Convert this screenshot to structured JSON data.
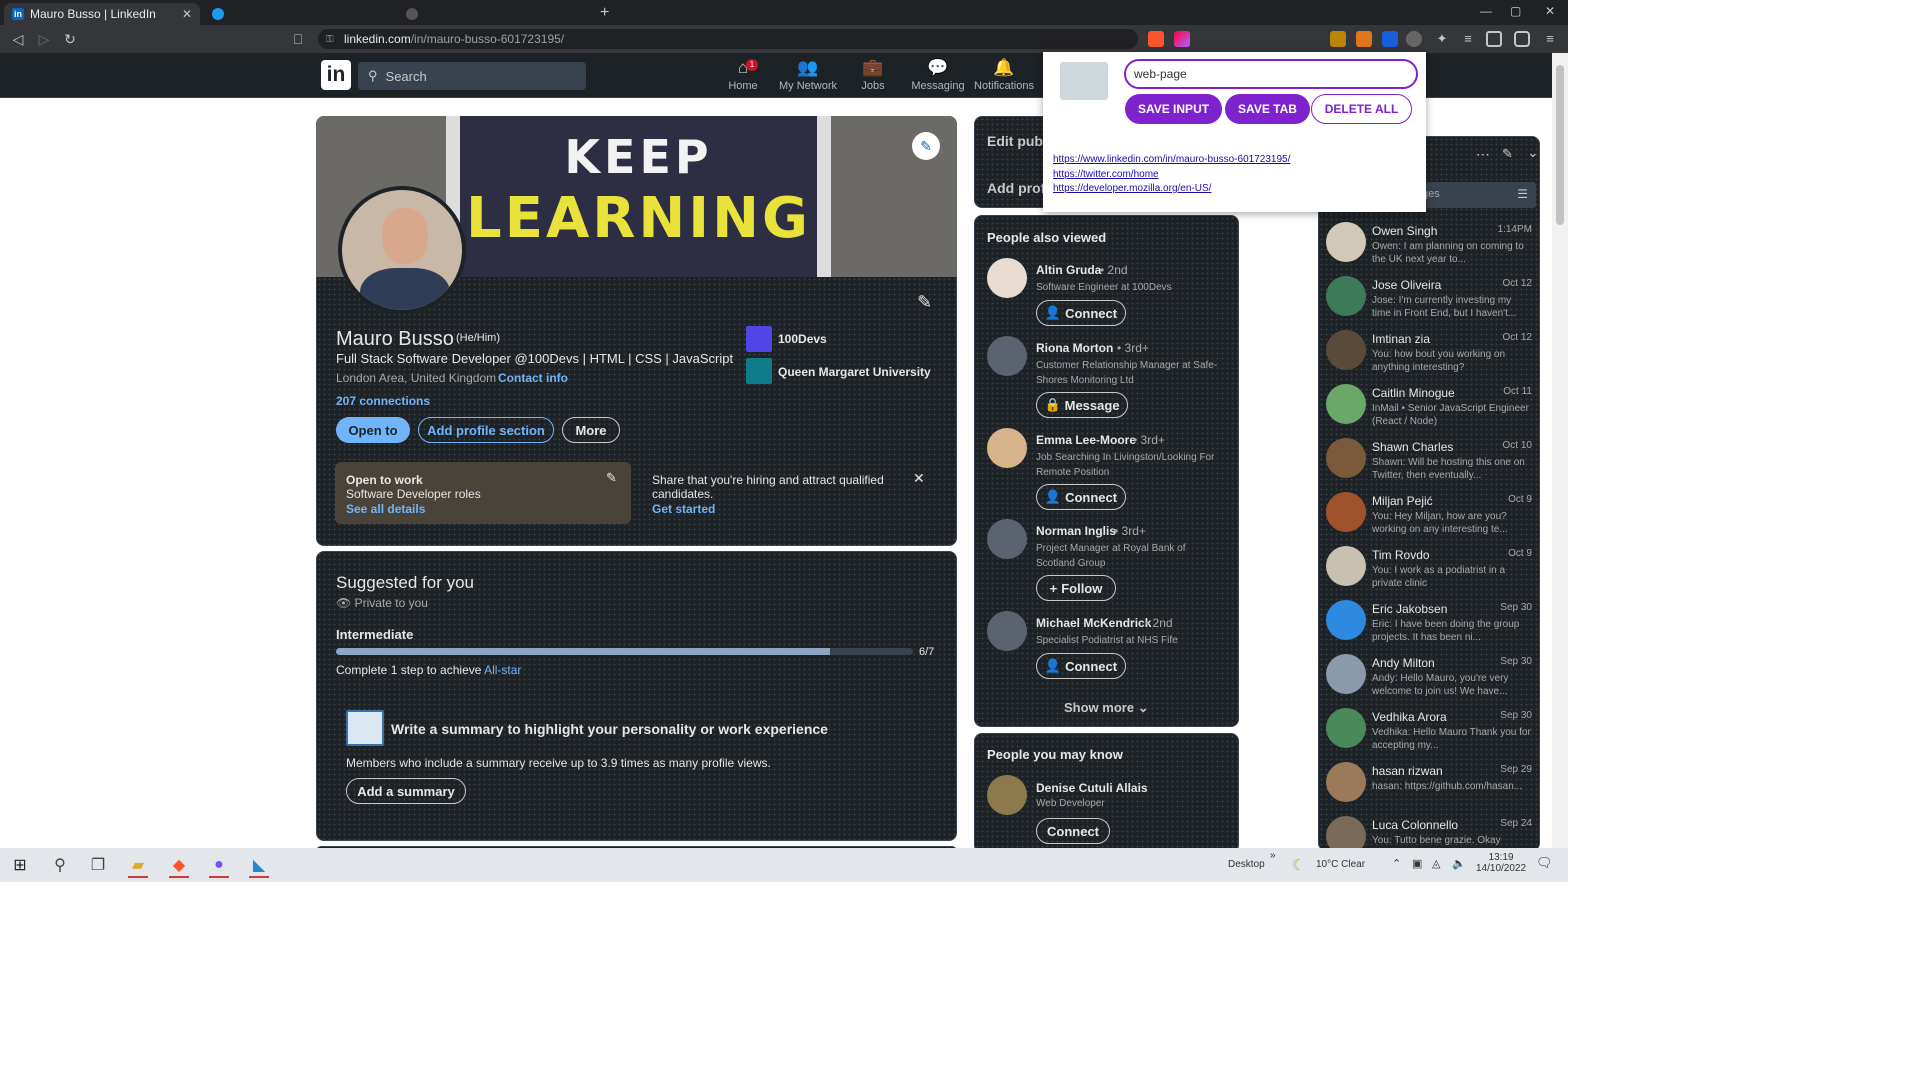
{
  "browser": {
    "active_tab_title": "Mauro Busso | LinkedIn",
    "url_host": "linkedin.com",
    "url_path": "/in/mauro-busso-601723195/",
    "new_tab_glyph": "+"
  },
  "linkedin_header": {
    "logo": "in",
    "search_placeholder": "Search",
    "nav": [
      {
        "label": "Home",
        "icon": "home-icon",
        "badge": "1"
      },
      {
        "label": "My Network",
        "icon": "network-icon"
      },
      {
        "label": "Jobs",
        "icon": "briefcase-icon"
      },
      {
        "label": "Messaging",
        "icon": "chat-icon"
      },
      {
        "label": "Notifications",
        "icon": "bell-icon"
      }
    ]
  },
  "profile": {
    "banner_line1": "KEEP",
    "banner_line2": "LEARNING",
    "name": "Mauro Busso",
    "pronouns": "(He/Him)",
    "headline": "Full Stack Software Developer @100Devs | HTML | CSS | JavaScript",
    "location": "London Area, United Kingdom",
    "contact_info": "Contact info",
    "connections": "207 connections",
    "orgs": [
      {
        "name": "100Devs",
        "color": "#4f46e5"
      },
      {
        "name": "Queen Margaret University",
        "color": "#0f7c8c"
      }
    ],
    "buttons": {
      "open_to": "Open to",
      "add_section": "Add profile section",
      "more": "More"
    },
    "open_to_work": {
      "title": "Open to work",
      "roles": "Software Developer roles",
      "link": "See all details"
    },
    "hiring": {
      "text": "Share that you're hiring and attract qualified candidates.",
      "link": "Get started"
    }
  },
  "suggested": {
    "title": "Suggested for you",
    "privacy": "Private to you",
    "level": "Intermediate",
    "progress": 0.857,
    "progress_label": "6/7",
    "step_text": "Complete 1 step to achieve",
    "step_link": "All-star",
    "summary_title": "Write a summary to highlight your personality or work experience",
    "summary_desc": "Members who include a summary receive up to 3.9 times as many profile views.",
    "summary_button": "Add a summary"
  },
  "right_col": {
    "edit_public": "Edit publ",
    "add_profile": "Add prof",
    "people_also_viewed_title": "People also viewed",
    "people_also_viewed": [
      {
        "name": "Altin Gruda",
        "degree": "• 2nd",
        "headline": "Software Engineer at 100Devs",
        "action": "Connect"
      },
      {
        "name": "Riona Morton",
        "degree": "• 3rd+",
        "headline": "Customer Relationship Manager at Safe-Shores Monitoring Ltd",
        "action": "Message"
      },
      {
        "name": "Emma Lee-Moore",
        "degree": "• 3rd+",
        "headline": "Job Searching In Livingston/Looking For Remote Position",
        "action": "Connect"
      },
      {
        "name": "Norman Inglis",
        "degree": "• 3rd+",
        "headline": "Project Manager at Royal Bank of Scotland Group",
        "action": "Follow"
      },
      {
        "name": "Michael McKendrick",
        "degree": "• 2nd",
        "headline": "Specialist Podiatrist at NHS Fife",
        "action": "Connect"
      }
    ],
    "show_more": "Show more",
    "people_may_know_title": "People you may know",
    "people_may_know": [
      {
        "name": "Denise Cutuli Allais",
        "headline": "Web Developer",
        "action": "Connect"
      }
    ]
  },
  "messaging": {
    "search_placeholder": "ges",
    "conversations": [
      {
        "name": "Owen Singh",
        "date": "1:14PM",
        "snippet": "Owen: I am planning on coming to the UK next year to..."
      },
      {
        "name": "Jose Oliveira",
        "date": "Oct 12",
        "snippet": "Jose: I'm currently investing my time in Front End, but I haven't..."
      },
      {
        "name": "Imtinan zia",
        "date": "Oct 12",
        "snippet": "You: how bout you working on anything interesting?"
      },
      {
        "name": "Caitlin Minogue",
        "date": "Oct 11",
        "snippet": "InMail • Senior JavaScript Engineer (React / Node)"
      },
      {
        "name": "Shawn Charles",
        "date": "Oct 10",
        "snippet": "Shawn: Will be hosting this one on Twitter, then eventually..."
      },
      {
        "name": "Miljan Pejić",
        "date": "Oct 9",
        "snippet": "You: Hey Miljan, how are you? working on any interesting te..."
      },
      {
        "name": "Tim Rovdo",
        "date": "Oct 9",
        "snippet": "You: I work as a podiatrist in a private clinic"
      },
      {
        "name": "Eric Jakobsen",
        "date": "Sep 30",
        "snippet": "Eric: I have been doing the group projects. It has been ni..."
      },
      {
        "name": "Andy Milton",
        "date": "Sep 30",
        "snippet": "Andy: Hello Mauro, you're very welcome to join us! We have..."
      },
      {
        "name": "Vedhika Arora",
        "date": "Sep 30",
        "snippet": "Vedhika: Hello Mauro Thank you for accepting my..."
      },
      {
        "name": "hasan rizwan",
        "date": "Sep 29",
        "snippet": "hasan: https://github.com/hasan..."
      },
      {
        "name": "Luca Colonnello",
        "date": "Sep 24",
        "snippet": "You: Tutto bene grazie. Okay"
      }
    ]
  },
  "extension_popup": {
    "input_value": "web-page",
    "save_input": "SAVE INPUT",
    "save_tab": "SAVE TAB",
    "delete_all": "DELETE ALL",
    "links": [
      "https://www.linkedin.com/in/mauro-busso-601723195/",
      "https://twitter.com/home",
      "https://developer.mozilla.org/en-US/"
    ]
  },
  "taskbar": {
    "desktop_label": "Desktop",
    "weather": "10°C Clear",
    "time": "13:19",
    "date": "14/10/2022"
  }
}
